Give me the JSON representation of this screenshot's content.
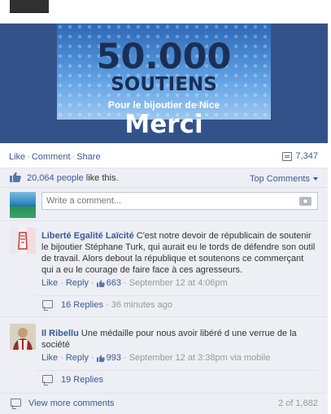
{
  "banner": {
    "number": "50.000",
    "word": "SOUTIENS",
    "subtitle": "Pour le bijoutier de Nice",
    "merci": "Merci"
  },
  "actions": {
    "like": "Like",
    "comment": "Comment",
    "share": "Share",
    "share_count": "7,347"
  },
  "likes": {
    "count": "20,064 people",
    "suffix": " like this.",
    "top_comments": "Top Comments"
  },
  "write": {
    "placeholder": "Write a comment..."
  },
  "comments": [
    {
      "author": "Liberté Egalité Laïcité",
      "text": " C'est notre devoir de républicain de soutenir le bijoutier Stéphane Turk, qui aurait eu le tords de défendre son outil de travail. Alors debout la république et soutenons ce commerçant qui a eu le courage de faire face à ces agresseurs.",
      "like": "Like",
      "reply": "Reply",
      "likes": "663",
      "time": "September 12 at 4:06pm",
      "via": "",
      "replies": "16 Replies",
      "replies_time": "36 minutes ago"
    },
    {
      "author": "Il Ribellu",
      "text": " Une médaille pour nous avoir libéré d une verrue de la société",
      "like": "Like",
      "reply": "Reply",
      "likes": "993",
      "time": "September 12 at 3:38pm",
      "via": "via mobile",
      "replies": "19 Replies",
      "replies_time": ""
    }
  ],
  "footer": {
    "view_more": "View more comments",
    "count": "2 of 1,682"
  },
  "colors": {
    "link": "#3b5998",
    "feed_bg": "#edeff4",
    "banner_bg": "#34528a"
  }
}
